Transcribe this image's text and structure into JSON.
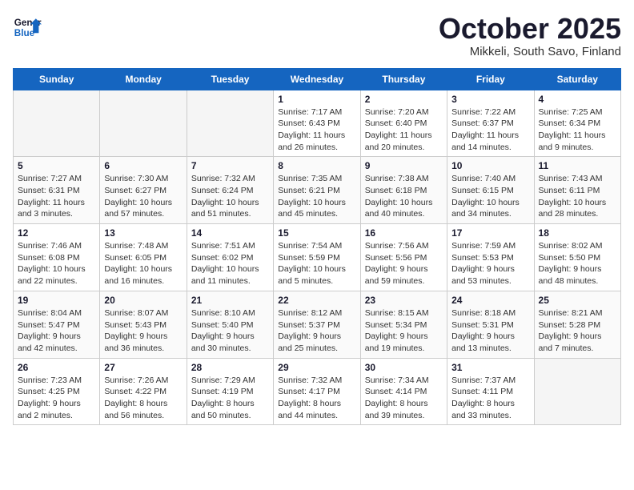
{
  "logo": {
    "line1": "General",
    "line2": "Blue"
  },
  "title": "October 2025",
  "subtitle": "Mikkeli, South Savo, Finland",
  "days_of_week": [
    "Sunday",
    "Monday",
    "Tuesday",
    "Wednesday",
    "Thursday",
    "Friday",
    "Saturday"
  ],
  "weeks": [
    [
      {
        "day": "",
        "detail": ""
      },
      {
        "day": "",
        "detail": ""
      },
      {
        "day": "",
        "detail": ""
      },
      {
        "day": "1",
        "detail": "Sunrise: 7:17 AM\nSunset: 6:43 PM\nDaylight: 11 hours\nand 26 minutes."
      },
      {
        "day": "2",
        "detail": "Sunrise: 7:20 AM\nSunset: 6:40 PM\nDaylight: 11 hours\nand 20 minutes."
      },
      {
        "day": "3",
        "detail": "Sunrise: 7:22 AM\nSunset: 6:37 PM\nDaylight: 11 hours\nand 14 minutes."
      },
      {
        "day": "4",
        "detail": "Sunrise: 7:25 AM\nSunset: 6:34 PM\nDaylight: 11 hours\nand 9 minutes."
      }
    ],
    [
      {
        "day": "5",
        "detail": "Sunrise: 7:27 AM\nSunset: 6:31 PM\nDaylight: 11 hours\nand 3 minutes."
      },
      {
        "day": "6",
        "detail": "Sunrise: 7:30 AM\nSunset: 6:27 PM\nDaylight: 10 hours\nand 57 minutes."
      },
      {
        "day": "7",
        "detail": "Sunrise: 7:32 AM\nSunset: 6:24 PM\nDaylight: 10 hours\nand 51 minutes."
      },
      {
        "day": "8",
        "detail": "Sunrise: 7:35 AM\nSunset: 6:21 PM\nDaylight: 10 hours\nand 45 minutes."
      },
      {
        "day": "9",
        "detail": "Sunrise: 7:38 AM\nSunset: 6:18 PM\nDaylight: 10 hours\nand 40 minutes."
      },
      {
        "day": "10",
        "detail": "Sunrise: 7:40 AM\nSunset: 6:15 PM\nDaylight: 10 hours\nand 34 minutes."
      },
      {
        "day": "11",
        "detail": "Sunrise: 7:43 AM\nSunset: 6:11 PM\nDaylight: 10 hours\nand 28 minutes."
      }
    ],
    [
      {
        "day": "12",
        "detail": "Sunrise: 7:46 AM\nSunset: 6:08 PM\nDaylight: 10 hours\nand 22 minutes."
      },
      {
        "day": "13",
        "detail": "Sunrise: 7:48 AM\nSunset: 6:05 PM\nDaylight: 10 hours\nand 16 minutes."
      },
      {
        "day": "14",
        "detail": "Sunrise: 7:51 AM\nSunset: 6:02 PM\nDaylight: 10 hours\nand 11 minutes."
      },
      {
        "day": "15",
        "detail": "Sunrise: 7:54 AM\nSunset: 5:59 PM\nDaylight: 10 hours\nand 5 minutes."
      },
      {
        "day": "16",
        "detail": "Sunrise: 7:56 AM\nSunset: 5:56 PM\nDaylight: 9 hours\nand 59 minutes."
      },
      {
        "day": "17",
        "detail": "Sunrise: 7:59 AM\nSunset: 5:53 PM\nDaylight: 9 hours\nand 53 minutes."
      },
      {
        "day": "18",
        "detail": "Sunrise: 8:02 AM\nSunset: 5:50 PM\nDaylight: 9 hours\nand 48 minutes."
      }
    ],
    [
      {
        "day": "19",
        "detail": "Sunrise: 8:04 AM\nSunset: 5:47 PM\nDaylight: 9 hours\nand 42 minutes."
      },
      {
        "day": "20",
        "detail": "Sunrise: 8:07 AM\nSunset: 5:43 PM\nDaylight: 9 hours\nand 36 minutes."
      },
      {
        "day": "21",
        "detail": "Sunrise: 8:10 AM\nSunset: 5:40 PM\nDaylight: 9 hours\nand 30 minutes."
      },
      {
        "day": "22",
        "detail": "Sunrise: 8:12 AM\nSunset: 5:37 PM\nDaylight: 9 hours\nand 25 minutes."
      },
      {
        "day": "23",
        "detail": "Sunrise: 8:15 AM\nSunset: 5:34 PM\nDaylight: 9 hours\nand 19 minutes."
      },
      {
        "day": "24",
        "detail": "Sunrise: 8:18 AM\nSunset: 5:31 PM\nDaylight: 9 hours\nand 13 minutes."
      },
      {
        "day": "25",
        "detail": "Sunrise: 8:21 AM\nSunset: 5:28 PM\nDaylight: 9 hours\nand 7 minutes."
      }
    ],
    [
      {
        "day": "26",
        "detail": "Sunrise: 7:23 AM\nSunset: 4:25 PM\nDaylight: 9 hours\nand 2 minutes."
      },
      {
        "day": "27",
        "detail": "Sunrise: 7:26 AM\nSunset: 4:22 PM\nDaylight: 8 hours\nand 56 minutes."
      },
      {
        "day": "28",
        "detail": "Sunrise: 7:29 AM\nSunset: 4:19 PM\nDaylight: 8 hours\nand 50 minutes."
      },
      {
        "day": "29",
        "detail": "Sunrise: 7:32 AM\nSunset: 4:17 PM\nDaylight: 8 hours\nand 44 minutes."
      },
      {
        "day": "30",
        "detail": "Sunrise: 7:34 AM\nSunset: 4:14 PM\nDaylight: 8 hours\nand 39 minutes."
      },
      {
        "day": "31",
        "detail": "Sunrise: 7:37 AM\nSunset: 4:11 PM\nDaylight: 8 hours\nand 33 minutes."
      },
      {
        "day": "",
        "detail": ""
      }
    ]
  ]
}
